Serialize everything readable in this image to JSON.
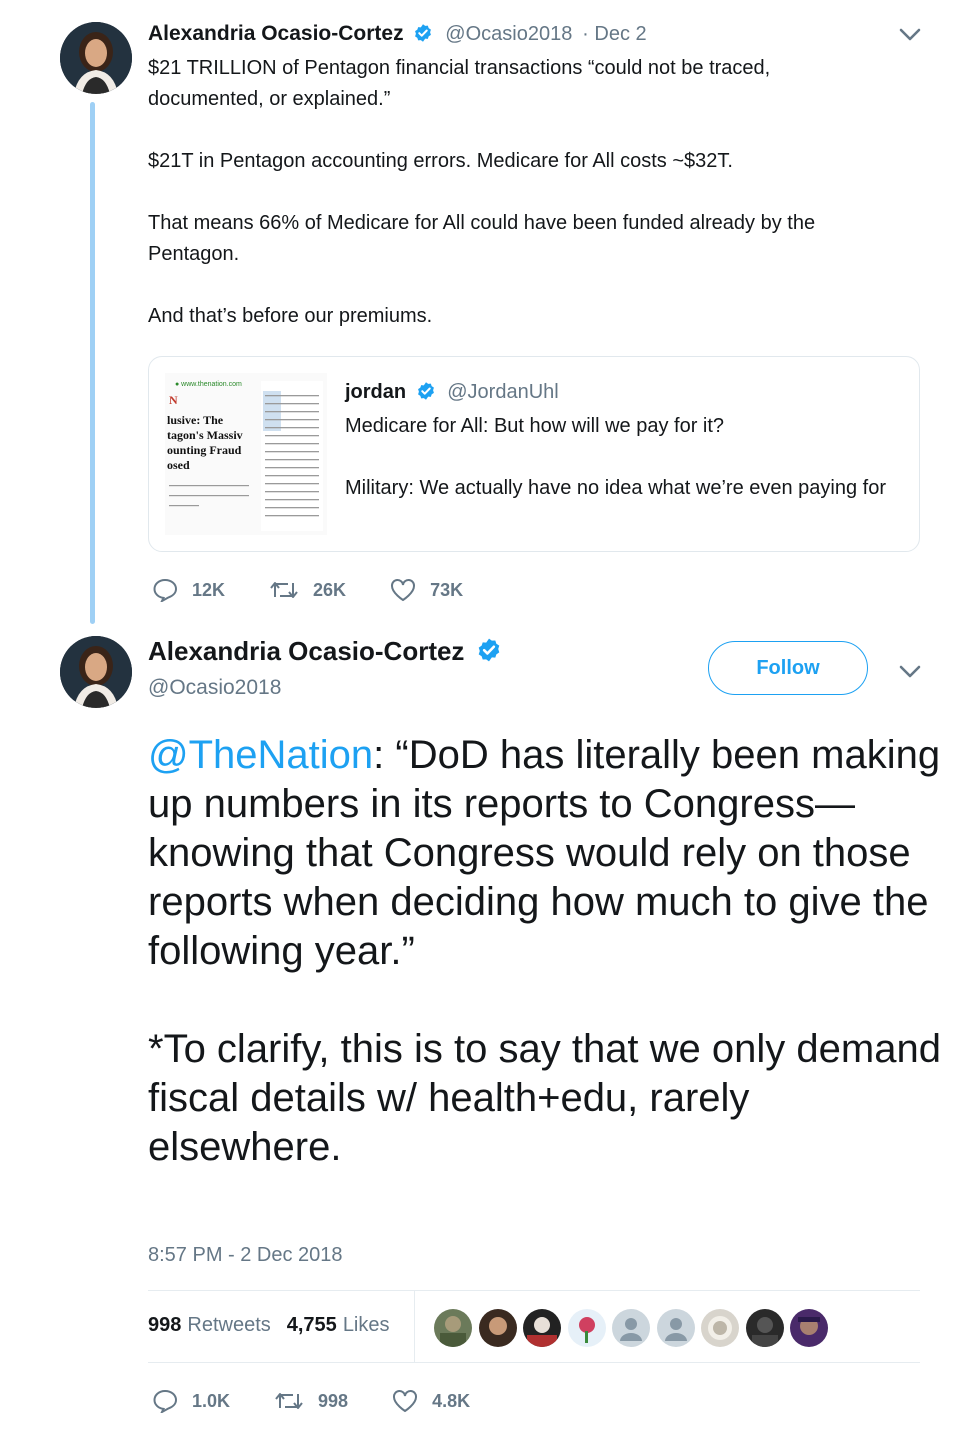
{
  "tweet1": {
    "author_name": "Alexandria Ocasio-Cortez",
    "author_handle": "@Ocasio2018",
    "date": "· Dec 2",
    "paragraphs": [
      "$21 TRILLION of Pentagon financial transactions “could not be traced, documented, or explained.”",
      "$21T in Pentagon accounting errors. Medicare for All costs ~$32T.",
      "That means 66% of Medicare for All could have been funded already by the Pentagon.",
      "And that’s before our premiums."
    ],
    "quote": {
      "author_name": "jordan",
      "author_handle": "@JordanUhl",
      "paragraphs": [
        "Medicare for All: But how will we pay for it?",
        "Military: We actually have no idea what we’re even paying for"
      ],
      "thumbnail": {
        "site": "● www.thenation.com",
        "logo": "N",
        "headline": [
          "lusive: The",
          "tagon's Massiv",
          "ounting Fraud",
          "osed"
        ]
      }
    },
    "actions": {
      "replies": "12K",
      "retweets": "26K",
      "likes": "73K"
    }
  },
  "tweet2": {
    "author_name": "Alexandria Ocasio-Cortez",
    "author_handle": "@Ocasio2018",
    "follow_label": "Follow",
    "mention": "@TheNation",
    "paragraph1_rest": ": “DoD has literally been making up numbers in its reports to Congress— knowing that Congress would rely on those reports when deciding how much to give the following year.”",
    "paragraph2": "*To clarify, this is to say that we only demand fiscal details w/ health+edu, rarely elsewhere.",
    "timestamp": "8:57 PM - 2 Dec 2018",
    "retweets_count": "998",
    "retweets_label": "Retweets",
    "likes_count": "4,755",
    "likes_label": "Likes",
    "actions": {
      "replies": "1.0K",
      "retweets": "998",
      "likes": "4.8K"
    }
  },
  "colors": {
    "accent": "#1da1f2",
    "muted": "#657786",
    "thread_line": "#9fd0f5",
    "retweet_green": "#17bf63"
  }
}
